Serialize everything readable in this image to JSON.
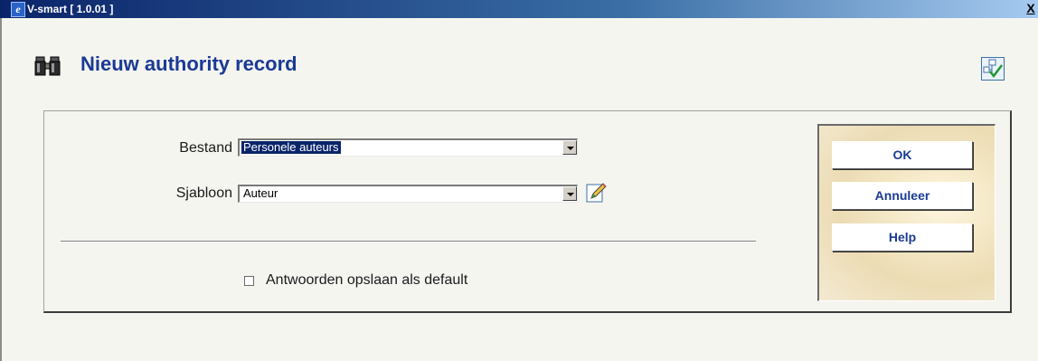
{
  "window": {
    "title": "V-smart [ 1.0.01 ]",
    "close_label": "X"
  },
  "header": {
    "title": "Nieuw authority record"
  },
  "form": {
    "bestand": {
      "label": "Bestand",
      "value": "Personele auteurs"
    },
    "sjabloon": {
      "label": "Sjabloon",
      "value": "Auteur"
    },
    "save_default": {
      "label": "Antwoorden opslaan als default",
      "checked": false
    }
  },
  "buttons": {
    "ok": "OK",
    "cancel": "Annuleer",
    "help": "Help"
  },
  "icons": {
    "app": "ie-icon",
    "header": "binoculars-icon",
    "header_right": "tree-check-icon",
    "edit": "pencil-edit-icon"
  },
  "colors": {
    "title_blue": "#1a3a94",
    "selection": "#0a246a"
  }
}
